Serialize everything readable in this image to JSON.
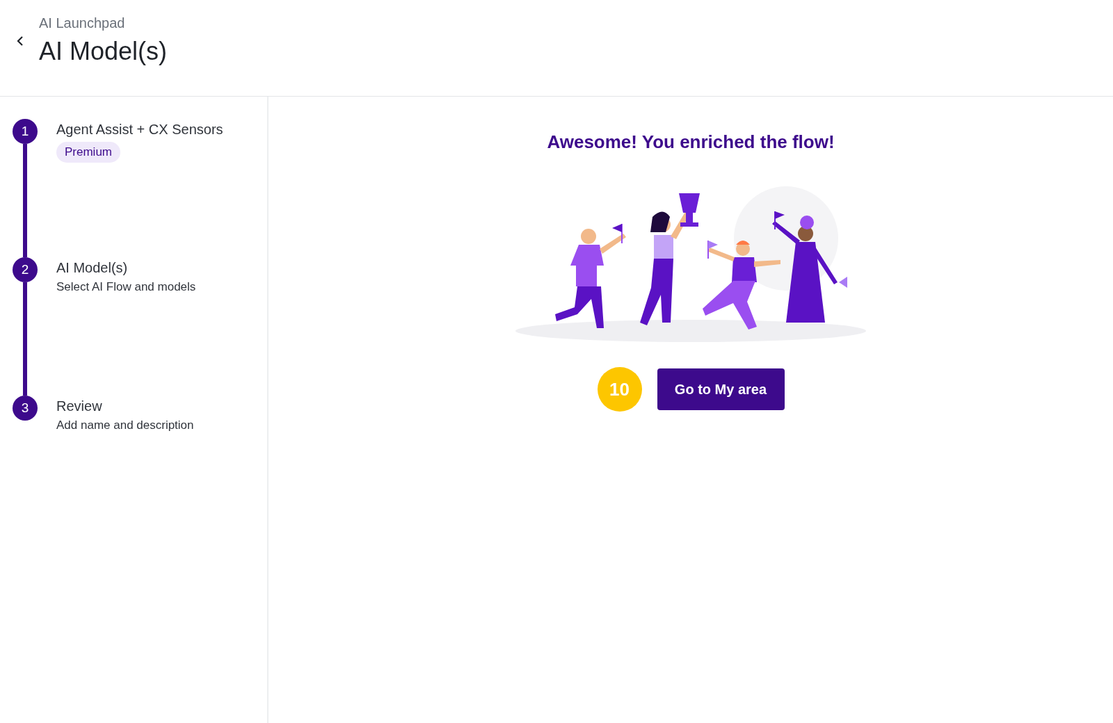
{
  "header": {
    "breadcrumb": "AI Launchpad",
    "title": "AI Model(s)"
  },
  "steps": [
    {
      "number": "1",
      "title": "Agent Assist + CX Sensors",
      "badge": "Premium"
    },
    {
      "number": "2",
      "title": "AI Model(s)",
      "subtitle": "Select AI Flow and models"
    },
    {
      "number": "3",
      "title": "Review",
      "subtitle": "Add name and description"
    }
  ],
  "success": {
    "heading": "Awesome! You enriched the flow!",
    "countdown": "10",
    "button": "Go to My area"
  }
}
